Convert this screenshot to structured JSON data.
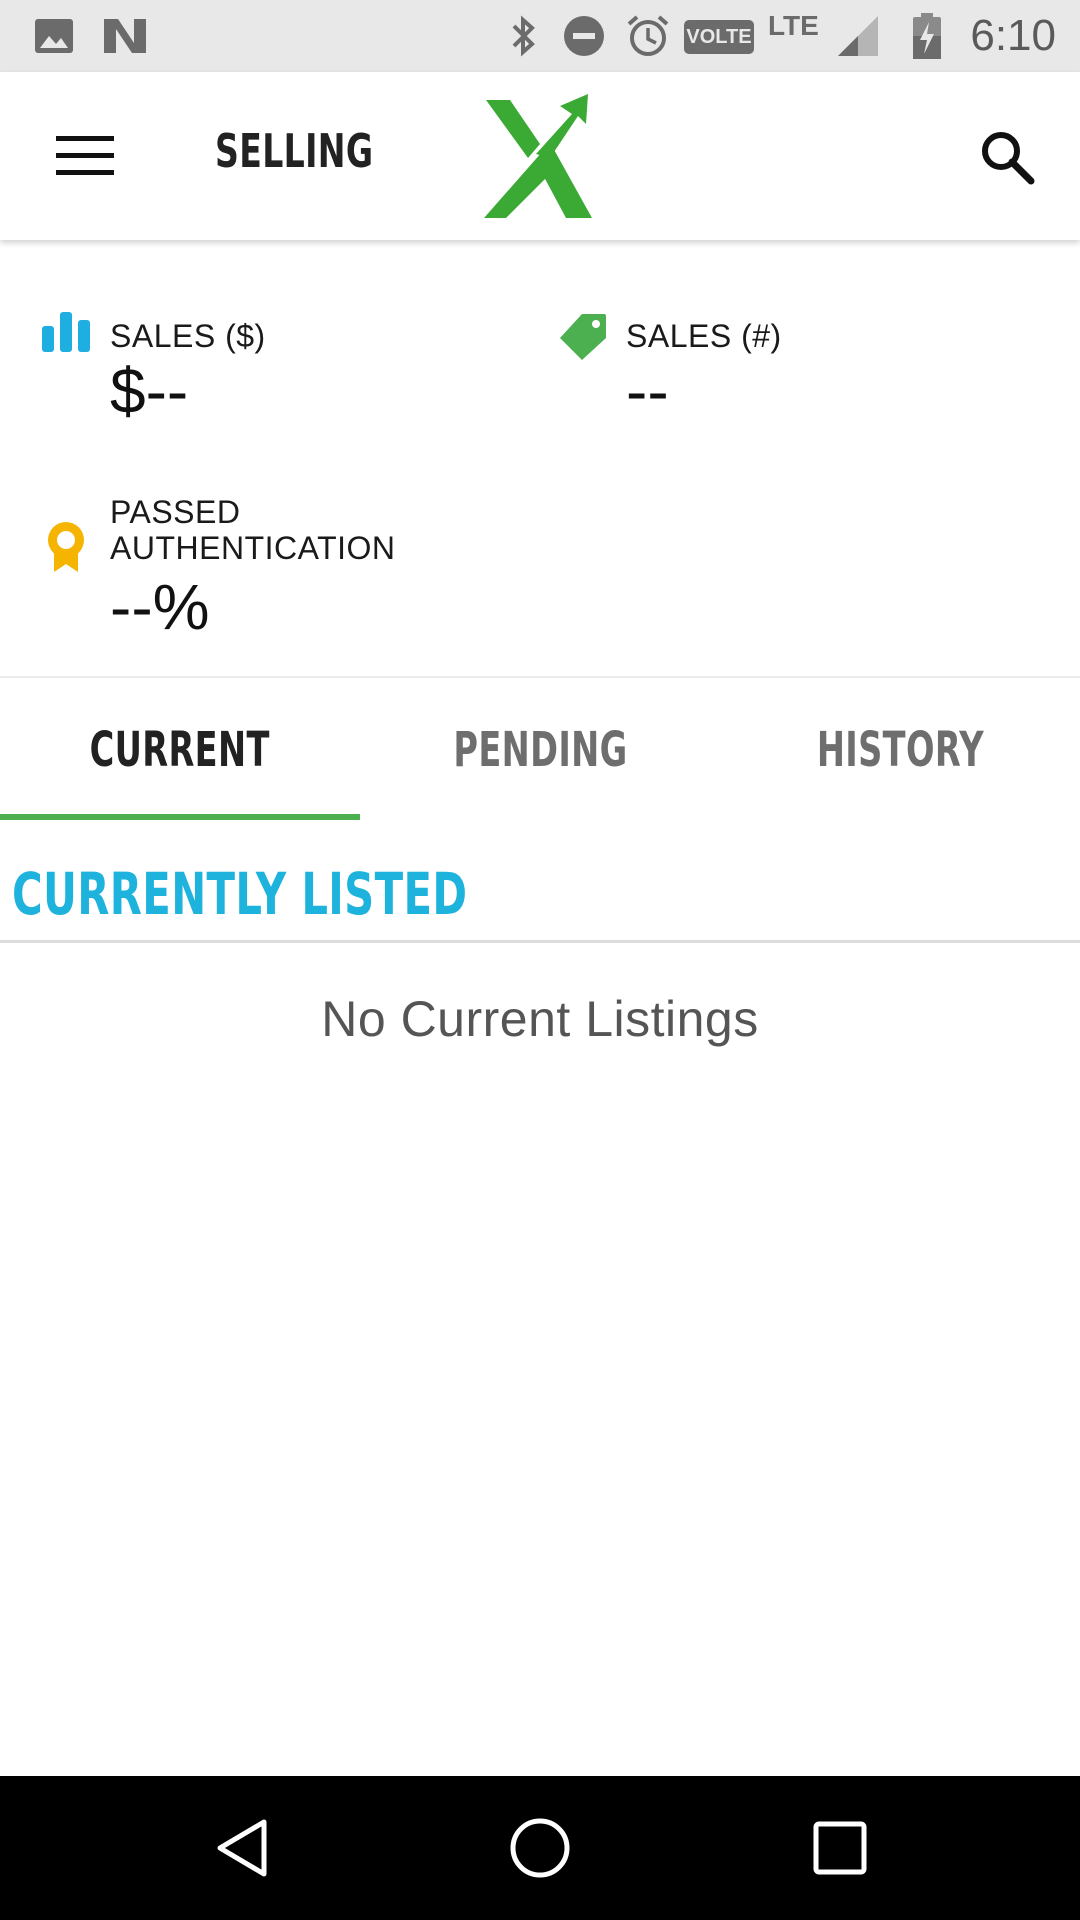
{
  "status_bar": {
    "time": "6:10",
    "volte": "VOLTE",
    "network": "LTE",
    "icons": [
      "image-icon",
      "n-icon",
      "bluetooth-icon",
      "do-not-disturb-icon",
      "alarm-icon",
      "signal-icon",
      "battery-charging-icon"
    ]
  },
  "app_bar": {
    "title": "SELLING",
    "menu_icon": "hamburger-menu-icon",
    "logo_icon": "stockx-logo",
    "search_icon": "search-icon"
  },
  "stats": {
    "sales_dollars": {
      "label": "SALES ($)",
      "value": "$--",
      "icon": "bar-chart-icon",
      "color": "#1eaee0"
    },
    "sales_count": {
      "label": "SALES (#)",
      "value": "--",
      "icon": "tag-icon",
      "color": "#4caf50"
    },
    "authentication": {
      "label_line1": "PASSED",
      "label_line2": "AUTHENTICATION",
      "value": "--%",
      "icon": "award-ribbon-icon",
      "color": "#f5b400"
    }
  },
  "tabs": [
    {
      "label": "CURRENT",
      "active": true
    },
    {
      "label": "PENDING",
      "active": false
    },
    {
      "label": "HISTORY",
      "active": false
    }
  ],
  "section": {
    "title": "CURRENTLY LISTED",
    "empty_message": "No Current Listings"
  },
  "colors": {
    "accent_green": "#4caf50",
    "section_blue": "#1eb3dc",
    "active_tab_text": "#222222",
    "inactive_tab_text": "#6e6e6e"
  },
  "nav_bar": {
    "buttons": [
      "back-icon",
      "home-icon",
      "recents-icon"
    ]
  }
}
